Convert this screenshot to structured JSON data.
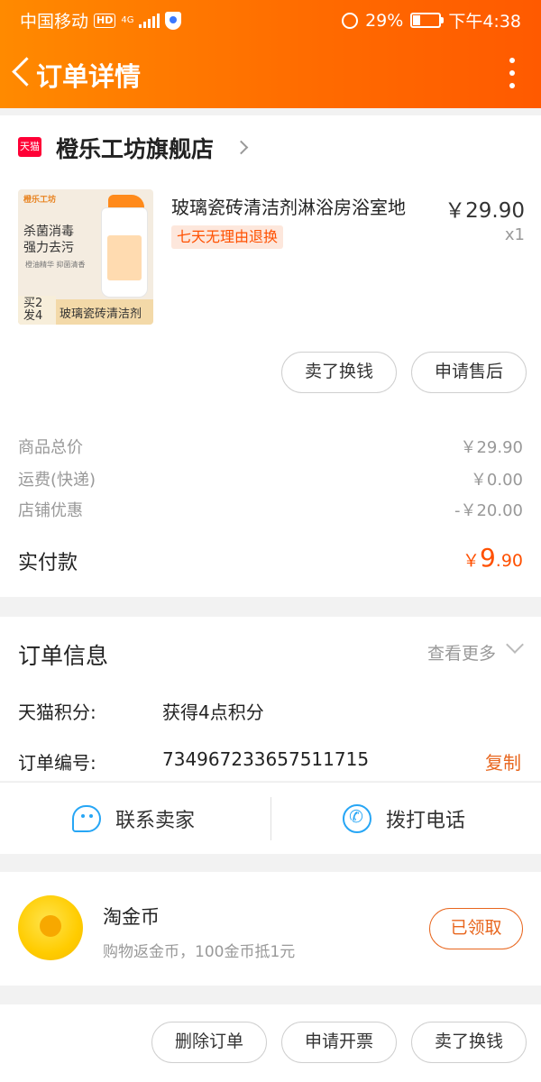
{
  "status_bar": {
    "carrier": "中国移动",
    "hd": "HD",
    "network": "4G",
    "battery_text": "29%",
    "battery_level": 0.29,
    "time": "下午4:38"
  },
  "nav": {
    "title": "订单详情"
  },
  "shop": {
    "badge": "天猫",
    "name": "橙乐工坊旗舰店"
  },
  "product": {
    "image": {
      "brand": "橙乐工坊",
      "line1": "杀菌消毒",
      "line2": "强力去污",
      "sub": "橙油精华 抑菌清香",
      "promo": "买2\n发4",
      "caption": "玻璃瓷砖清洁剂"
    },
    "title": "玻璃瓷砖清洁剂淋浴房浴室地",
    "price": "￥29.90",
    "qty": "x1",
    "tag": "七天无理由退换",
    "actions": [
      "卖了换钱",
      "申请售后"
    ]
  },
  "summary": {
    "rows": [
      {
        "label": "商品总价",
        "value": "￥29.90"
      },
      {
        "label": "运费(快递)",
        "value": "￥0.00"
      },
      {
        "label": "店铺优惠",
        "value": "-￥20.00"
      }
    ],
    "paid_label": "实付款",
    "paid_symbol": "￥",
    "paid_int": "9",
    "paid_dec": ".90"
  },
  "order_info": {
    "title": "订单信息",
    "more": "查看更多",
    "points_label": "天猫积分:",
    "points_value": "获得4点积分",
    "number_label": "订单编号:",
    "number_value": "734967233657511715",
    "copy": "复制"
  },
  "contact": {
    "seller": "联系卖家",
    "call": "拨打电话"
  },
  "coins": {
    "title": "淘金币",
    "subtitle": "购物返金币，100金币抵1元",
    "button": "已领取"
  },
  "bottom_actions": [
    "删除订单",
    "申请开票",
    "卖了换钱"
  ],
  "colors": {
    "header_start": "#ff8a00",
    "header_end": "#ff5a00",
    "accent": "#ff5000",
    "link_blue": "#27a6f5"
  }
}
